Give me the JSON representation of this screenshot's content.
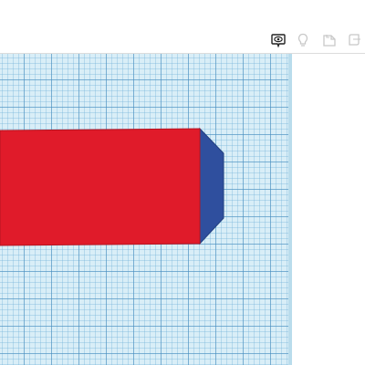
{
  "toolbar": {
    "buttons": [
      {
        "name": "show-all-view-button",
        "icon": "eye-bubble-icon",
        "active": true
      },
      {
        "name": "lightbulb-button",
        "icon": "lightbulb-icon",
        "active": false
      },
      {
        "name": "note-button",
        "icon": "note-icon",
        "active": false
      },
      {
        "name": "shape-button",
        "icon": "shape-icon",
        "active": false
      }
    ]
  },
  "workplane": {
    "grid_color": "#d9eef7",
    "object": {
      "type": "box",
      "top_face_color": "#e01b2a",
      "side_face_color": "#2f4f9e"
    }
  },
  "colors": {
    "toolbar_icon_active": "#222222",
    "toolbar_icon_inactive": "#c8c8c8"
  }
}
